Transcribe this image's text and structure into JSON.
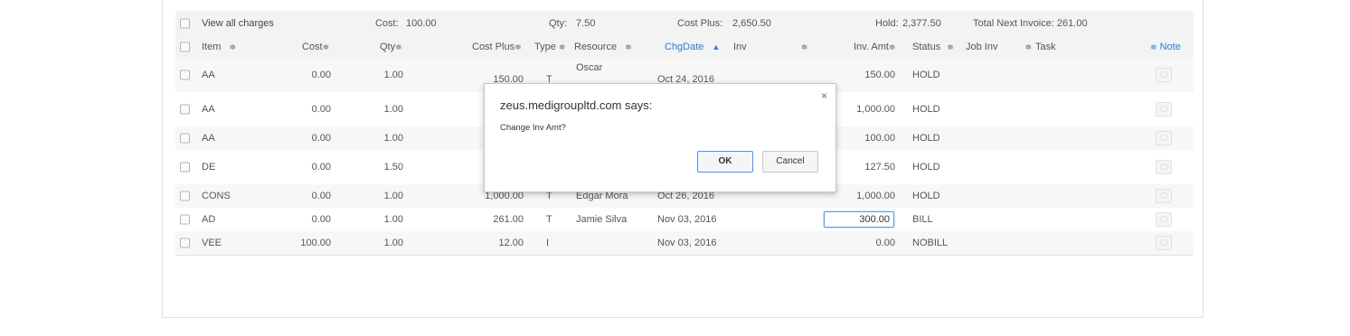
{
  "summary": {
    "view_all": "View all charges",
    "cost_label": "Cost:",
    "cost_value": "100.00",
    "qty_label": "Qty:",
    "qty_value": "7.50",
    "cost_plus_label": "Cost Plus:",
    "cost_plus_value": "2,650.50",
    "hold_label": "Hold:",
    "hold_value": "2,377.50",
    "total_next_invoice": "Total Next Invoice: 261.00"
  },
  "columns": {
    "item": "Item",
    "cost": "Cost",
    "qty": "Qty",
    "cost_plus": "Cost Plus",
    "type": "Type",
    "resource": "Resource",
    "chgdate": "ChgDate",
    "inv": "Inv",
    "inv_amt": "Inv. Amt",
    "status": "Status",
    "job_inv": "Job Inv",
    "task": "Task",
    "note": "Note"
  },
  "rows": [
    {
      "item": "AA",
      "cost": "0.00",
      "qty": "1.00",
      "cost_plus": "150.00",
      "type": "T",
      "resource": "Oscar",
      "chgdate": "Oct 24, 2016",
      "inv_amt": "150.00",
      "status": "HOLD"
    },
    {
      "item": "AA",
      "cost": "0.00",
      "qty": "1.00",
      "cost_plus": "",
      "type": "",
      "resource": "",
      "chgdate": "",
      "inv_amt": "1,000.00",
      "status": "HOLD"
    },
    {
      "item": "AA",
      "cost": "0.00",
      "qty": "1.00",
      "cost_plus": "",
      "type": "",
      "resource": "",
      "chgdate": "",
      "inv_amt": "100.00",
      "status": "HOLD"
    },
    {
      "item": "DE",
      "cost": "0.00",
      "qty": "1.50",
      "cost_plus": "",
      "type": "",
      "resource": "",
      "chgdate": "",
      "inv_amt": "127.50",
      "status": "HOLD"
    },
    {
      "item": "CONS",
      "cost": "0.00",
      "qty": "1.00",
      "cost_plus": "1,000.00",
      "type": "T",
      "resource": "Edgar Mora",
      "chgdate": "Oct 26, 2016",
      "inv_amt": "1,000.00",
      "status": "HOLD"
    },
    {
      "item": "AD",
      "cost": "0.00",
      "qty": "1.00",
      "cost_plus": "261.00",
      "type": "T",
      "resource": "Jamie Silva",
      "chgdate": "Nov 03, 2016",
      "inv_amt": "300.00",
      "status": "BILL"
    },
    {
      "item": "VEE",
      "cost": "100.00",
      "qty": "1.00",
      "cost_plus": "12.00",
      "type": "I",
      "resource": "",
      "chgdate": "Nov 03, 2016",
      "inv_amt": "0.00",
      "status": "NOBILL"
    }
  ],
  "dialog": {
    "title": "zeus.medigroupltd.com says:",
    "message": "Change Inv Amt?",
    "ok_label": "OK",
    "cancel_label": "Cancel",
    "close_glyph": "×"
  },
  "icons": {
    "sort": "sort-icon",
    "sort_up": "sort-up-icon",
    "note": "note-icon",
    "close": "close-icon"
  },
  "colors": {
    "header_bg": "#f3f3f3",
    "link_blue": "#2a7fd4",
    "input_border": "#5b9dd9",
    "ok_border": "#4d90fe"
  }
}
